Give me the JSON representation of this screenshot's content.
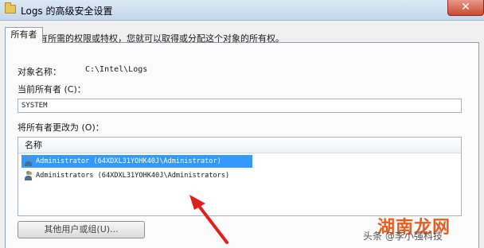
{
  "window": {
    "title": "Logs 的高级安全设置",
    "close_glyph": "✕"
  },
  "tabs": [
    {
      "label": "所有者"
    }
  ],
  "content": {
    "description": "如果您有所需的权限或特权，您就可以取得或分配这个对象的所有权。",
    "object_name_label": "对象名称：",
    "object_name_value": "C:\\Intel\\Logs",
    "current_owner_label": "当前所有者 (C)：",
    "current_owner_value": "SYSTEM",
    "change_owner_label": "将所有者更改为 (O)：",
    "list_header": "名称",
    "owners": [
      {
        "name": "Administrator (64XDXL31YOHK40J\\Administrator)",
        "icon": "user-icon",
        "selected": true
      },
      {
        "name": "Administrators (64XDXL31YOHK40J\\Administrators)",
        "icon": "group-icon",
        "selected": false
      }
    ],
    "other_users_button": "其他用户或组(U)..."
  },
  "watermark": {
    "main": "湖南龙网",
    "sub": "头条 @李小强科技"
  },
  "colors": {
    "selection": "#3399ff",
    "arrow": "#e0201c",
    "watermark": "#e85c22"
  }
}
